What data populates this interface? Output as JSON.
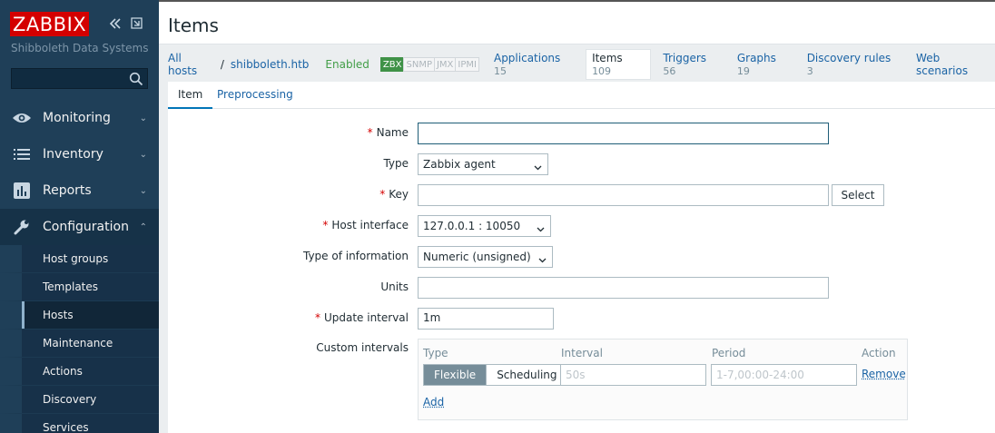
{
  "sidebar": {
    "logo": "ZABBIX",
    "subtitle": "Shibboleth Data Systems",
    "menu": [
      {
        "label": "Monitoring",
        "icon": "eye-icon"
      },
      {
        "label": "Inventory",
        "icon": "list-icon"
      },
      {
        "label": "Reports",
        "icon": "bar-chart-icon"
      },
      {
        "label": "Configuration",
        "icon": "wrench-icon"
      }
    ],
    "submenu": [
      "Host groups",
      "Templates",
      "Hosts",
      "Maintenance",
      "Actions",
      "Discovery",
      "Services"
    ],
    "selected_submenu": "Hosts"
  },
  "header": {
    "title": "Items"
  },
  "nav": {
    "all_hosts": "All hosts",
    "separator": "/",
    "host": "shibboleth.htb",
    "status": "Enabled",
    "availability": [
      "ZBX",
      "SNMP",
      "JMX",
      "IPMI"
    ],
    "tabs": [
      {
        "label": "Applications",
        "count": "15"
      },
      {
        "label": "Items",
        "count": "109"
      },
      {
        "label": "Triggers",
        "count": "56"
      },
      {
        "label": "Graphs",
        "count": "19"
      },
      {
        "label": "Discovery rules",
        "count": "3"
      },
      {
        "label": "Web scenarios",
        "count": ""
      }
    ]
  },
  "form": {
    "tabs": [
      "Item",
      "Preprocessing"
    ],
    "name_label": "Name",
    "name_value": "",
    "type_label": "Type",
    "type_value": "Zabbix agent",
    "key_label": "Key",
    "key_value": "",
    "select_button": "Select",
    "interface_label": "Host interface",
    "interface_value": "127.0.0.1 : 10050",
    "info_label": "Type of information",
    "info_value": "Numeric (unsigned)",
    "units_label": "Units",
    "units_value": "",
    "update_label": "Update interval",
    "update_value": "1m",
    "custom_label": "Custom intervals",
    "custom": {
      "col_type": "Type",
      "col_interval": "Interval",
      "col_period": "Period",
      "col_action": "Action",
      "flexible": "Flexible",
      "scheduling": "Scheduling",
      "interval_placeholder": "50s",
      "period_placeholder": "1-7,00:00-24:00",
      "remove": "Remove",
      "add": "Add"
    }
  },
  "colors": {
    "brand": "#d40000",
    "sidebar": "#1f3f58",
    "link": "#1a63a5",
    "enabled": "#429e47"
  }
}
